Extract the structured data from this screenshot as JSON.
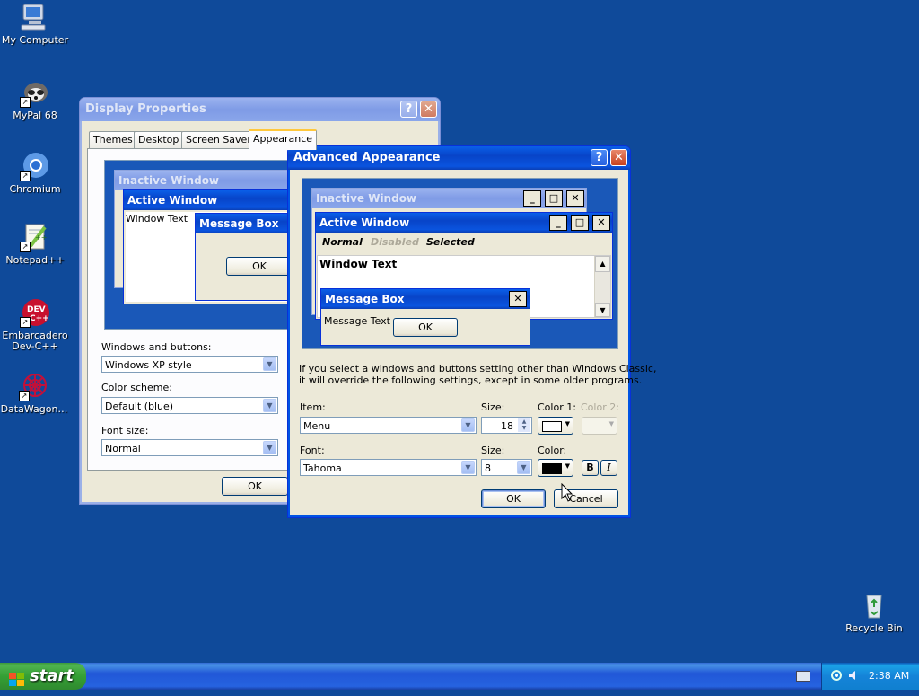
{
  "desktop": {
    "icons": [
      {
        "label": "My Computer",
        "icon": "computer-icon"
      },
      {
        "label": "MyPal 68",
        "icon": "raccoon-browser-icon"
      },
      {
        "label": "Chromium",
        "icon": "chromium-icon"
      },
      {
        "label": "Notepad++",
        "icon": "notepad-plus-plus-icon"
      },
      {
        "label": "Embarcadero Dev-C++",
        "label_line1": "Embarcadero",
        "label_line2": "Dev-C++",
        "icon": "devcpp-icon"
      },
      {
        "label": "DataWagon…",
        "icon": "datawagon-icon"
      },
      {
        "label": "Recycle Bin",
        "icon": "recycle-bin-icon"
      }
    ]
  },
  "display_properties": {
    "title": "Display Properties",
    "help_glyph": "?",
    "close_glyph": "✕",
    "tabs": [
      "Themes",
      "Desktop",
      "Screen Saver",
      "Appearance"
    ],
    "active_tab": "Appearance",
    "preview": {
      "inactive_title": "Inactive Window",
      "active_title": "Active Window",
      "window_text": "Window Text",
      "message_box_title": "Message Box",
      "ok_label": "OK"
    },
    "windows_and_buttons_label": "Windows and buttons:",
    "windows_and_buttons_value": "Windows XP style",
    "color_scheme_label": "Color scheme:",
    "color_scheme_value": "Default (blue)",
    "font_size_label": "Font size:",
    "font_size_value": "Normal",
    "ok_label": "OK"
  },
  "advanced_appearance": {
    "title": "Advanced Appearance",
    "help_glyph": "?",
    "close_glyph": "✕",
    "preview": {
      "inactive_title": "Inactive Window",
      "active_title": "Active Window",
      "menu_normal": "Normal",
      "menu_disabled": "Disabled",
      "menu_selected": "Selected",
      "window_text": "Window Text",
      "message_box_title": "Message Box",
      "message_text": "Message Text",
      "ok_label": "OK",
      "minimize_glyph": "_",
      "maximize_glyph": "□",
      "close_glyph": "✕"
    },
    "info_line1": "If you select a windows and buttons setting other than Windows Classic,",
    "info_line2": "it will override the following settings, except in some older programs.",
    "item_label": "Item:",
    "item_value": "Menu",
    "size_label": "Size:",
    "item_size_value": "18",
    "color1_label": "Color 1:",
    "color2_label": "Color 2:",
    "font_label": "Font:",
    "font_value": "Tahoma",
    "font_size_label": "Size:",
    "font_size_value": "8",
    "color_label": "Color:",
    "bold_label": "B",
    "italic_label": "I",
    "ok_label": "OK",
    "cancel_label": "Cancel",
    "colors": {
      "color1": "#ffffff",
      "font_color": "#000000"
    }
  },
  "taskbar": {
    "start_label": "start",
    "clock": "2:38 AM"
  },
  "colors": {
    "desktop": "#0f4a9a",
    "title_active": "#0a54df",
    "window_face": "#ece9d8"
  }
}
